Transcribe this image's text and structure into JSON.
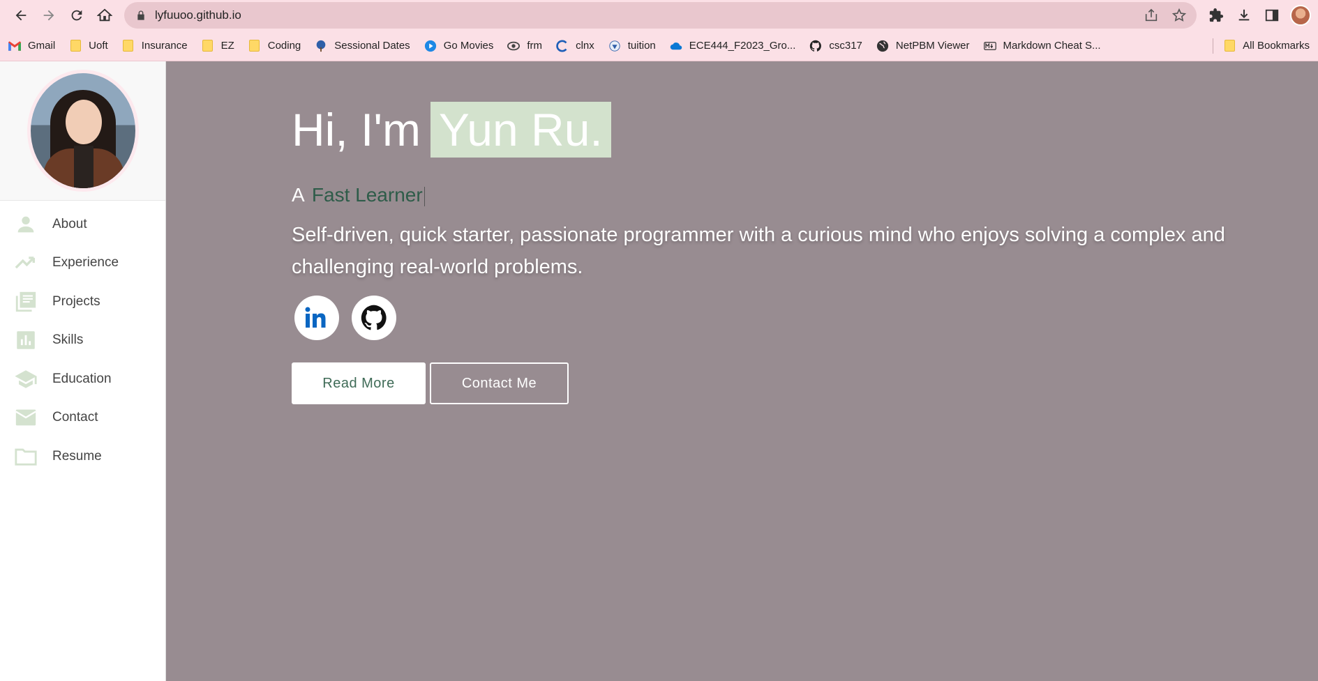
{
  "browser": {
    "url": "lyfuuoo.github.io",
    "bookmarks": [
      {
        "label": "Gmail",
        "icon": "gmail-icon"
      },
      {
        "label": "Uoft",
        "icon": "folder-icon"
      },
      {
        "label": "Insurance",
        "icon": "folder-icon"
      },
      {
        "label": "EZ",
        "icon": "folder-icon"
      },
      {
        "label": "Coding",
        "icon": "folder-icon"
      },
      {
        "label": "Sessional Dates",
        "icon": "tree-icon"
      },
      {
        "label": "Go Movies",
        "icon": "play-icon"
      },
      {
        "label": "frm",
        "icon": "eye-icon"
      },
      {
        "label": "clnx",
        "icon": "clnx-icon"
      },
      {
        "label": "tuition",
        "icon": "crest-icon"
      },
      {
        "label": "ECE444_F2023_Gro...",
        "icon": "cloud-icon"
      },
      {
        "label": "csc317",
        "icon": "github-icon"
      },
      {
        "label": "NetPBM Viewer",
        "icon": "globe-icon"
      },
      {
        "label": "Markdown Cheat S...",
        "icon": "markdown-icon"
      }
    ],
    "all_bookmarks": "All Bookmarks"
  },
  "sidebar": {
    "items": [
      {
        "label": "About",
        "icon": "person-icon"
      },
      {
        "label": "Experience",
        "icon": "trending-up-icon"
      },
      {
        "label": "Projects",
        "icon": "library-books-icon"
      },
      {
        "label": "Skills",
        "icon": "bar-chart-icon"
      },
      {
        "label": "Education",
        "icon": "school-icon"
      },
      {
        "label": "Contact",
        "icon": "mail-icon"
      },
      {
        "label": "Resume",
        "icon": "folder-outline-icon"
      }
    ]
  },
  "hero": {
    "greeting": "Hi, I'm",
    "name": "Yun Ru.",
    "tagline_prefix": "A",
    "tagline_role": "Fast Learner",
    "description": "Self-driven, quick starter, passionate programmer with a curious mind who enjoys solving a complex and challenging real-world problems.",
    "read_more": "Read More",
    "contact_me": "Contact Me"
  },
  "colors": {
    "hero_bg": "#988c91",
    "accent_green": "#d3e2cd",
    "role_text": "#2e5c49",
    "chrome_pink": "#fbe0e6"
  }
}
